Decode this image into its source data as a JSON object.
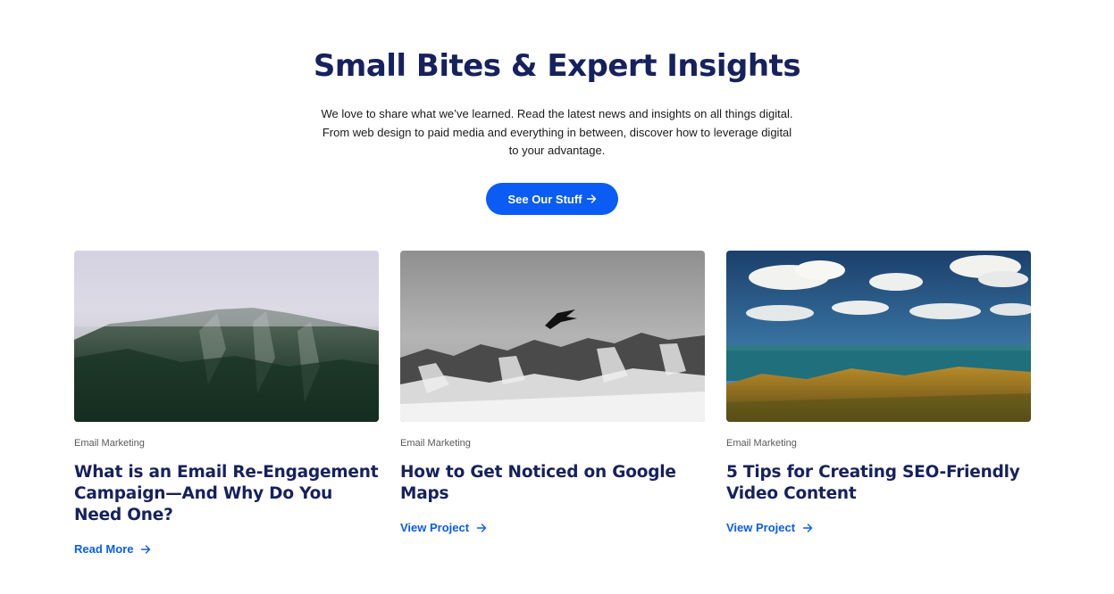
{
  "hero": {
    "title": "Small Bites & Expert Insights",
    "description": "We love to share what we’ve learned. Read the latest news and insights on all things digital. From web design to paid media and everything in between, discover how to leverage digital to your advantage.",
    "cta_label": "See Our Stuff"
  },
  "colors": {
    "heading": "#16215e",
    "accent": "#0a5cf5",
    "category": "#5a5a5a"
  },
  "cards": [
    {
      "image": "misty-green-mountains",
      "category": "Email Marketing",
      "title": "What is an Email Re-Engagement Campaign—And Why Do You Need One?",
      "link_label": "Read More"
    },
    {
      "image": "snowy-mountains-with-bird",
      "category": "Email Marketing",
      "title": "How to Get Noticed on Google Maps",
      "link_label": "View Project"
    },
    {
      "image": "sea-meadow-clouds",
      "category": "Email Marketing",
      "title": "5 Tips for Creating SEO-Friendly Video Content",
      "link_label": "View Project"
    }
  ]
}
